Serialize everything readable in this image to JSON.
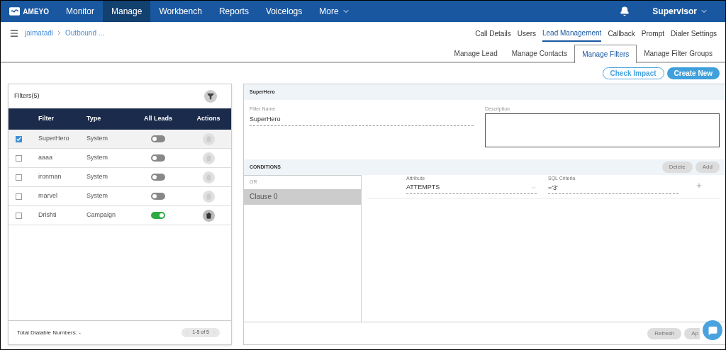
{
  "nav": {
    "logo": "AMEYO",
    "items": [
      {
        "label": "Monitor",
        "selected": false
      },
      {
        "label": "Manage",
        "selected": true
      },
      {
        "label": "Workbench",
        "selected": false
      },
      {
        "label": "Reports",
        "selected": false
      },
      {
        "label": "Voicelogs",
        "selected": false
      }
    ],
    "more": "More",
    "user": "Supervisor"
  },
  "breadcrumb": [
    "jaimatadi",
    "Outbound ..."
  ],
  "top_tabs": [
    {
      "label": "Call Details",
      "selected": false
    },
    {
      "label": "Users",
      "selected": false
    },
    {
      "label": "Lead Management",
      "selected": true
    },
    {
      "label": "Callback",
      "selected": false
    },
    {
      "label": "Prompt",
      "selected": false
    },
    {
      "label": "Dialer Settings",
      "selected": false
    }
  ],
  "sub_tabs": [
    {
      "label": "Manage Lead",
      "selected": false
    },
    {
      "label": "Manage Contacts",
      "selected": false
    },
    {
      "label": "Manage Filters",
      "selected": true
    },
    {
      "label": "Manage Filter Groups",
      "selected": false
    }
  ],
  "actions": [
    "Check Impact",
    "Create New"
  ],
  "filters": {
    "title": "Filters(5)",
    "columns": [
      "Filter",
      "Type",
      "All Leads",
      "Actions"
    ],
    "rows": [
      {
        "name": "SuperHero",
        "type": "System",
        "selected": true,
        "on": false,
        "disabled": true
      },
      {
        "name": "aaaa",
        "type": "System",
        "selected": false,
        "on": false,
        "disabled": true
      },
      {
        "name": "ironman",
        "type": "System",
        "selected": false,
        "on": false,
        "disabled": true
      },
      {
        "name": "marvel",
        "type": "System",
        "selected": false,
        "on": false,
        "disabled": true
      },
      {
        "name": "Drishti",
        "type": "Campaign",
        "selected": false,
        "on": true,
        "disabled": false
      }
    ],
    "total": "Total Dialable Numbers: -",
    "pager": "1-5 of 5"
  },
  "detail": {
    "title": "SuperHero",
    "filter_name_label": "Filter Name",
    "filter_name": "SuperHero",
    "description_label": "Description",
    "conditions": "CONDITIONS",
    "buttons": [
      "Delete",
      "Add"
    ],
    "or": "OR",
    "clauses": [
      {
        "label": "Clause 0",
        "selected": true
      }
    ],
    "attribute_label": "Attribute",
    "attribute": "ATTEMPTS",
    "criteria_label": "SQL Criteria",
    "criteria": "='3'",
    "footer_buttons": [
      "Refresh",
      "Ap"
    ]
  }
}
